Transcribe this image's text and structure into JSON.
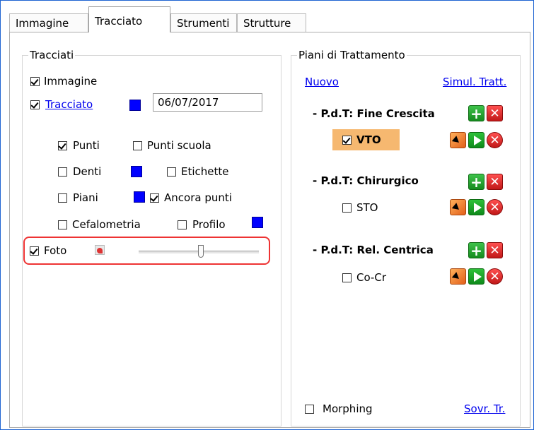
{
  "tabs": [
    "Immagine",
    "Tracciato",
    "Strumenti",
    "Strutture"
  ],
  "tracciati": {
    "title": "Tracciati",
    "immagine": {
      "label": "Immagine",
      "checked": true
    },
    "tracciato": {
      "label": "Tracciato",
      "checked": true,
      "date": "06/07/2017"
    },
    "punti": {
      "label": "Punti",
      "checked": true
    },
    "punti_scuola": {
      "label": "Punti scuola",
      "checked": false
    },
    "denti": {
      "label": "Denti",
      "checked": false
    },
    "etichette": {
      "label": "Etichette",
      "checked": false
    },
    "piani": {
      "label": "Piani",
      "checked": false
    },
    "ancora_punti": {
      "label": "Ancora punti",
      "checked": true
    },
    "cefalometria": {
      "label": "Cefalometria",
      "checked": false
    },
    "profilo": {
      "label": "Profilo",
      "checked": false
    },
    "foto": {
      "label": "Foto",
      "checked": true,
      "opacity_level": 0.52
    }
  },
  "piani": {
    "title": "Piani di Trattamento",
    "nuovo": "Nuovo",
    "simul": "Simul. Tratt.",
    "plans": [
      {
        "title": "- P.d.T: Fine Crescita",
        "item": "VTO",
        "checked": true,
        "highlighted": true
      },
      {
        "title": "- P.d.T: Chirurgico",
        "item": "STO",
        "checked": false,
        "highlighted": false
      },
      {
        "title": "- P.d.T: Rel. Centrica",
        "item": "Co-Cr",
        "checked": false,
        "highlighted": false
      }
    ],
    "morphing": {
      "label": "Morphing",
      "checked": false
    },
    "sovr": "Sovr. Tr."
  },
  "colors": {
    "swatch": "#0000ff",
    "highlight": "#f6b870",
    "outline": "#e33333"
  },
  "icons": [
    "add-icon",
    "delete-icon",
    "cursor-icon",
    "play-icon",
    "photo-icon"
  ]
}
